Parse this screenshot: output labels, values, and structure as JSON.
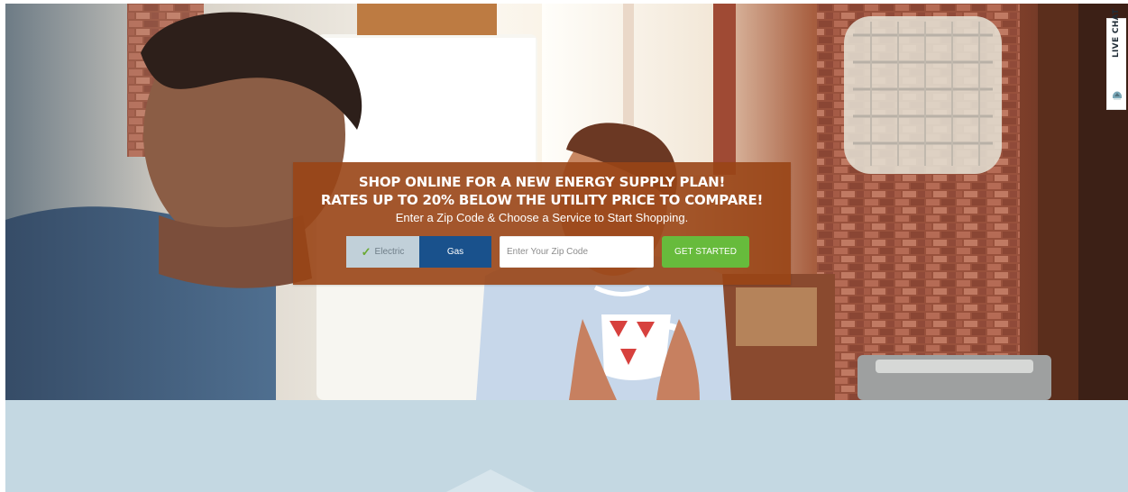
{
  "promo": {
    "headline_line_1": "SHOP ONLINE FOR A NEW ENERGY SUPPLY PLAN!",
    "headline_line_2": "RATES UP TO 20% BELOW THE UTILITY PRICE TO COMPARE!",
    "instruction": "Enter a Zip Code & Choose a Service to Start Shopping."
  },
  "service_toggle": {
    "electric_label": "Electric",
    "gas_label": "Gas",
    "selected_check_icon": "check-icon"
  },
  "zip_search": {
    "placeholder": "Enter Your Zip Code",
    "value": "",
    "button_label": "GET STARTED"
  },
  "live_chat": {
    "label": "LIVE CHAT",
    "icon": "chat-logo-icon"
  },
  "colors": {
    "panel": "#99451699",
    "electric_background": "#c1d0d9",
    "gas_background": "#19518c",
    "button_background": "#67bb3c",
    "lower_band": "#c4d8e2"
  }
}
